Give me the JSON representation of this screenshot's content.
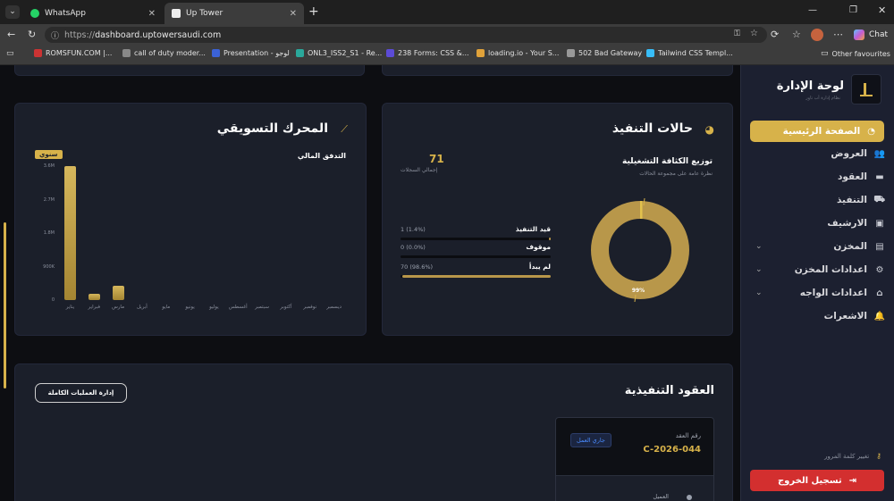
{
  "browser": {
    "tabs": [
      {
        "title": "WhatsApp",
        "icon": "whatsapp-icon",
        "active": false
      },
      {
        "title": "Up Tower",
        "icon": "site-icon",
        "active": true
      }
    ],
    "url_scheme": "https://",
    "url_host": "dashboard.uptowersaudi.com",
    "chat_label": "Chat",
    "bookmarks": [
      "ROMSFUN.COM |...",
      "call of duty moder...",
      "Presentation - لوجو",
      "ONL3_ISS2_S1 - Re...",
      "238 Forms: CSS &...",
      "loading.io - Your S...",
      "502 Bad Gateway",
      "Tailwind CSS Templ..."
    ],
    "other_favourites": "Other favourites"
  },
  "sidebar": {
    "title": "لوحة الإدارة",
    "subtitle": "نظام إدارة أب تاور",
    "active_item": "الصفحة الرئيسية",
    "items": [
      "العروض",
      "العقود",
      "التنفيذ",
      "الارشيف",
      "المخزن",
      "اعدادات المخزن",
      "اعدادات الواجه",
      "الاشعرات"
    ],
    "change_password": "تغيير كلمة المرور",
    "logout": "تسجيل الخروج"
  },
  "execution": {
    "title": "حالات التنفيذ",
    "subtitle": "توزيع الكثافة التشغيلية",
    "caption": "نظرة عامة على مجموعة الحالات",
    "total_value": "71",
    "total_label": "إجمالي السجلات",
    "rows": [
      {
        "label": "قيد التنفيذ",
        "value": "1 (1.4%)",
        "pct": 1.4
      },
      {
        "label": "موقوف",
        "value": "0 (0.0%)",
        "pct": 0
      },
      {
        "label": "لم يبدأ",
        "value": "70 (98.6%)",
        "pct": 98.6
      }
    ],
    "donut_label": "99%"
  },
  "marketing": {
    "title": "المحرك التسويقي",
    "subtitle": "التدفق المالي",
    "range_badge": "سنوي"
  },
  "chart_data": {
    "type": "bar",
    "title": "التدفق المالي",
    "categories": [
      "يناير",
      "فبراير",
      "مارس",
      "أبريل",
      "مايو",
      "يونيو",
      "يوليو",
      "أغسطس",
      "سبتمبر",
      "أكتوبر",
      "نوفمبر",
      "ديسمبر"
    ],
    "values": [
      3.6,
      0.16,
      0.38,
      0,
      0,
      0,
      0,
      0,
      0,
      0,
      0,
      0
    ],
    "ytick_labels": [
      "0",
      "900K",
      "1.8M",
      "2.7M",
      "3.6M"
    ],
    "ylim": [
      0,
      3.6
    ],
    "xlabel": "",
    "ylabel": "",
    "grid": false
  },
  "contracts": {
    "title": "العقود التنفيذية",
    "manage_button": "إدارة العمليات الكاملة",
    "card": {
      "number_label": "رقم العقد",
      "number": "C-2026-044",
      "status": "جاري العمل",
      "client_label": "العميل"
    }
  },
  "colors": {
    "accent": "#d7b24a",
    "danger": "#d32f2f",
    "card": "#1b1f2a",
    "status_blue": "#4a8cff"
  }
}
